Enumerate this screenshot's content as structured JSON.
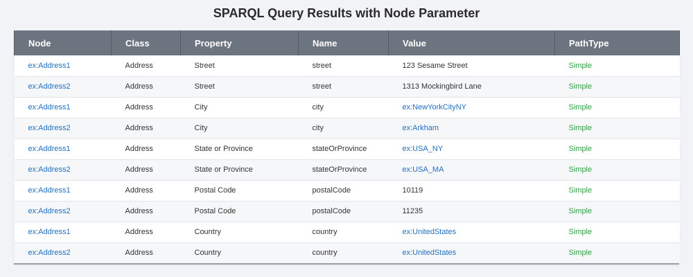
{
  "title": "SPARQL Query Results with Node Parameter",
  "colors": {
    "header_bg": "#6c747f",
    "link": "#1f6fbf",
    "path_type": "#2e9e44"
  },
  "columns": [
    "Node",
    "Class",
    "Property",
    "Name",
    "Value",
    "PathType"
  ],
  "rows": [
    {
      "node": "ex:Address1",
      "class": "Address",
      "property": "Street",
      "name": "street",
      "value": "123 Sesame Street",
      "value_is_link": false,
      "path_type": "Simple"
    },
    {
      "node": "ex:Address2",
      "class": "Address",
      "property": "Street",
      "name": "street",
      "value": "1313 Mockingbird Lane",
      "value_is_link": false,
      "path_type": "Simple"
    },
    {
      "node": "ex:Address1",
      "class": "Address",
      "property": "City",
      "name": "city",
      "value": "ex:NewYorkCityNY",
      "value_is_link": true,
      "path_type": "Simple"
    },
    {
      "node": "ex:Address2",
      "class": "Address",
      "property": "City",
      "name": "city",
      "value": "ex:Arkham",
      "value_is_link": true,
      "path_type": "Simple"
    },
    {
      "node": "ex:Address1",
      "class": "Address",
      "property": "State or Province",
      "name": "stateOrProvince",
      "value": "ex:USA_NY",
      "value_is_link": true,
      "path_type": "Simple"
    },
    {
      "node": "ex:Address2",
      "class": "Address",
      "property": "State or Province",
      "name": "stateOrProvince",
      "value": "ex:USA_MA",
      "value_is_link": true,
      "path_type": "Simple"
    },
    {
      "node": "ex:Address1",
      "class": "Address",
      "property": "Postal Code",
      "name": "postalCode",
      "value": "10119",
      "value_is_link": false,
      "path_type": "Simple"
    },
    {
      "node": "ex:Address2",
      "class": "Address",
      "property": "Postal Code",
      "name": "postalCode",
      "value": "11235",
      "value_is_link": false,
      "path_type": "Simple"
    },
    {
      "node": "ex:Address1",
      "class": "Address",
      "property": "Country",
      "name": "country",
      "value": "ex:UnitedStates",
      "value_is_link": true,
      "path_type": "Simple"
    },
    {
      "node": "ex:Address2",
      "class": "Address",
      "property": "Country",
      "name": "country",
      "value": "ex:UnitedStates",
      "value_is_link": true,
      "path_type": "Simple"
    }
  ]
}
